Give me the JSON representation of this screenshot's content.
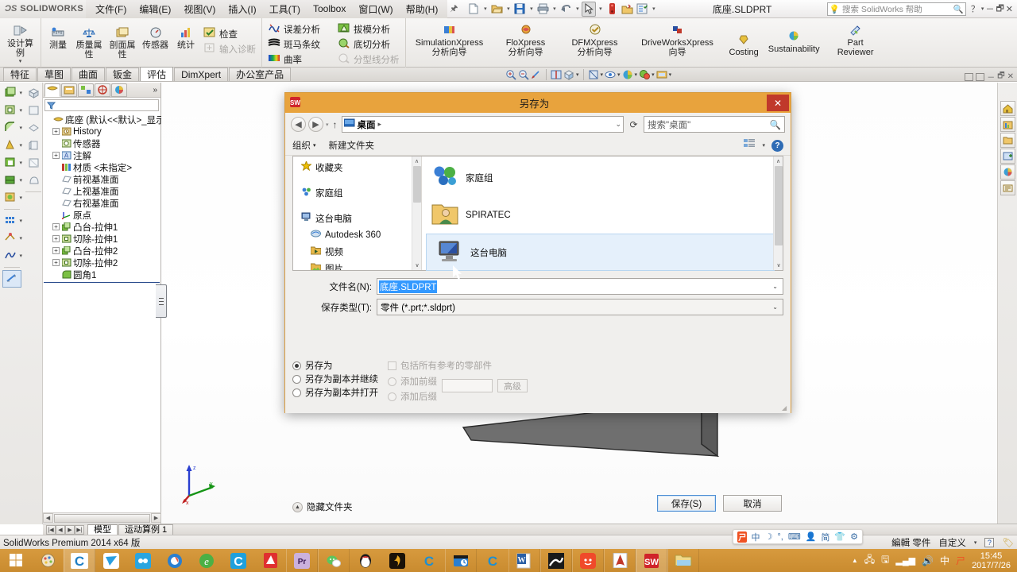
{
  "app": {
    "brand_ds": "ƆS",
    "brand_name": "SOLIDWORKS",
    "document_title": "底座.SLDPRT",
    "help_placeholder": "搜索 SolidWorks 帮助",
    "status_text": "SolidWorks Premium 2014 x64 版",
    "status_edit": "編輯 零件",
    "status_custom": "自定义",
    "accent": "#d79a3e"
  },
  "menu": {
    "items": [
      {
        "label": "文件(F)",
        "name": "menu-file"
      },
      {
        "label": "编辑(E)",
        "name": "menu-edit"
      },
      {
        "label": "视图(V)",
        "name": "menu-view"
      },
      {
        "label": "插入(I)",
        "name": "menu-insert"
      },
      {
        "label": "工具(T)",
        "name": "menu-tools"
      },
      {
        "label": "Toolbox",
        "name": "menu-toolbox"
      },
      {
        "label": "窗口(W)",
        "name": "menu-window"
      },
      {
        "label": "帮助(H)",
        "name": "menu-help"
      }
    ],
    "pin_icon": "pin-icon"
  },
  "quick_access": [
    {
      "name": "new-doc-icon",
      "caret": true
    },
    {
      "name": "open-doc-icon",
      "caret": true
    },
    {
      "name": "save-icon",
      "caret": true
    },
    {
      "name": "print-icon",
      "caret": true
    },
    {
      "name": "undo-icon",
      "caret": true
    },
    {
      "name": "select-icon",
      "caret": true,
      "selected": true
    },
    {
      "name": "rebuild-icon",
      "caret": false
    },
    {
      "name": "options-icon",
      "caret": false
    },
    {
      "name": "settings-icon",
      "caret": true
    }
  ],
  "ribbon": {
    "groups": [
      {
        "name": "design-study-group",
        "buttons": [
          {
            "label": "设计算例",
            "name": "design-study-button",
            "icon": "design-study-icon",
            "caret": true
          }
        ]
      },
      {
        "name": "evaluate-tools-group",
        "buttons": [
          {
            "label": "测量",
            "name": "measure-button",
            "icon": "measure-icon"
          },
          {
            "label": "质量属性",
            "name": "mass-properties-button",
            "icon": "mass-properties-icon"
          },
          {
            "label": "剖面属性",
            "name": "section-properties-button",
            "icon": "section-properties-icon"
          },
          {
            "label": "传感器",
            "name": "sensor-button",
            "icon": "sensor-icon"
          },
          {
            "label": "统计",
            "name": "statistics-button",
            "icon": "statistics-icon"
          }
        ],
        "rows": [
          {
            "label": "检查",
            "name": "check-button",
            "icon": "check-icon",
            "disabled": false
          },
          {
            "label": "输入诊断",
            "name": "import-diagnostics-button",
            "icon": "import-diagnostics-icon",
            "disabled": true
          }
        ]
      },
      {
        "name": "analysis-group",
        "rows": [
          {
            "label": "误差分析",
            "name": "deviation-analysis-button",
            "icon": "deviation-analysis-icon",
            "disabled": false
          },
          {
            "label": "斑马条纹",
            "name": "zebra-stripes-button",
            "icon": "zebra-stripes-icon",
            "disabled": false
          },
          {
            "label": "曲率",
            "name": "curvature-button",
            "icon": "curvature-icon",
            "disabled": false
          },
          {
            "label": "拔模分析",
            "name": "draft-analysis-button",
            "icon": "draft-analysis-icon",
            "disabled": false
          },
          {
            "label": "底切分析",
            "name": "undercut-analysis-button",
            "icon": "undercut-analysis-icon",
            "disabled": false
          },
          {
            "label": "分型线分析",
            "name": "parting-line-analysis-button",
            "icon": "parting-line-analysis-icon",
            "disabled": true
          }
        ]
      },
      {
        "name": "xpress-group",
        "buttons": [
          {
            "label": "SimulationXpress 分析向导",
            "name": "simulationxpress-button",
            "icon": "simulationxpress-icon"
          },
          {
            "label": "FloXpress 分析向导",
            "name": "floxpress-button",
            "icon": "floxpress-icon"
          },
          {
            "label": "DFMXpress 分析向导",
            "name": "dfmxpress-button",
            "icon": "dfmxpress-icon"
          },
          {
            "label": "DriveWorksXpress 向导",
            "name": "driveworksxpress-button",
            "icon": "driveworksxpress-icon"
          },
          {
            "label": "Costing",
            "name": "costing-button",
            "icon": "costing-icon"
          },
          {
            "label": "Sustainability",
            "name": "sustainability-button",
            "icon": "sustainability-icon"
          },
          {
            "label": "Part Reviewer",
            "name": "part-reviewer-button",
            "icon": "part-reviewer-icon"
          }
        ]
      }
    ]
  },
  "command_tabs": [
    {
      "label": "特征",
      "name": "tab-features",
      "active": false
    },
    {
      "label": "草图",
      "name": "tab-sketch",
      "active": false
    },
    {
      "label": "曲面",
      "name": "tab-surfaces",
      "active": false
    },
    {
      "label": "钣金",
      "name": "tab-sheetmetal",
      "active": false
    },
    {
      "label": "评估",
      "name": "tab-evaluate",
      "active": true
    },
    {
      "label": "DimXpert",
      "name": "tab-dimxpert",
      "active": false
    },
    {
      "label": "办公室产品",
      "name": "tab-office-products",
      "active": false
    }
  ],
  "view_toolbar": [
    {
      "name": "zoom-to-fit-icon",
      "caret": false
    },
    {
      "name": "zoom-to-area-icon",
      "caret": false
    },
    {
      "name": "previous-view-icon",
      "caret": false
    },
    {
      "name": "section-view-icon",
      "caret": false
    },
    {
      "name": "view-orientation-icon",
      "caret": true
    },
    {
      "name": "display-style-icon",
      "caret": true
    },
    {
      "name": "hide-show-items-icon",
      "caret": true
    },
    {
      "name": "edit-appearance-icon",
      "caret": true
    },
    {
      "name": "apply-scene-icon",
      "caret": true
    },
    {
      "name": "view-settings-icon",
      "caret": true
    }
  ],
  "feature_tree": {
    "tabs": [
      {
        "name": "feature-manager-tab",
        "active": true
      },
      {
        "name": "property-manager-tab",
        "active": false
      },
      {
        "name": "configuration-manager-tab",
        "active": false
      },
      {
        "name": "dimxpert-manager-tab",
        "active": false
      },
      {
        "name": "display-manager-tab",
        "active": false
      }
    ],
    "more_label": "»",
    "filter_icon": "filter-icon",
    "root": "底座  (默认<<默认>_显示状态",
    "nodes": [
      {
        "label": "History",
        "icon": "history-icon",
        "expandable": true,
        "indent": 1
      },
      {
        "label": "传感器",
        "icon": "sensor-tree-icon",
        "expandable": false,
        "indent": 1
      },
      {
        "label": "注解",
        "icon": "annotations-icon",
        "expandable": true,
        "indent": 1
      },
      {
        "label": "材质 <未指定>",
        "icon": "material-icon",
        "expandable": false,
        "indent": 1
      },
      {
        "label": "前视基准面",
        "icon": "plane-icon",
        "expandable": false,
        "indent": 1
      },
      {
        "label": "上视基准面",
        "icon": "plane-icon",
        "expandable": false,
        "indent": 1
      },
      {
        "label": "右视基准面",
        "icon": "plane-icon",
        "expandable": false,
        "indent": 1
      },
      {
        "label": "原点",
        "icon": "origin-icon",
        "expandable": false,
        "indent": 1
      },
      {
        "label": "凸台-拉伸1",
        "icon": "boss-extrude-icon",
        "expandable": true,
        "indent": 1
      },
      {
        "label": "切除-拉伸1",
        "icon": "cut-extrude-icon",
        "expandable": true,
        "indent": 1
      },
      {
        "label": "凸台-拉伸2",
        "icon": "boss-extrude-icon",
        "expandable": true,
        "indent": 1
      },
      {
        "label": "切除-拉伸2",
        "icon": "cut-extrude-icon",
        "expandable": true,
        "indent": 1
      },
      {
        "label": "圆角1",
        "icon": "fillet-icon",
        "expandable": false,
        "indent": 1
      }
    ]
  },
  "graphics_tabs": {
    "nav": [
      "|◀",
      "◀",
      "▶",
      "▶|"
    ],
    "tabs": [
      {
        "label": "模型",
        "name": "model-tab",
        "active": true
      },
      {
        "label": "运动算例 1",
        "name": "motion-study-tab",
        "active": false
      }
    ]
  },
  "triad": {
    "x": "x",
    "y": "y",
    "z": "z"
  },
  "dialog": {
    "title": "另存为",
    "icon": "solidworks-app-icon",
    "close_label": "✕",
    "nav": {
      "back": "◀",
      "forward": "▶",
      "recent_caret": "▾",
      "up": "↑",
      "breadcrumb_icon": "desktop-icon",
      "breadcrumb": "桌面",
      "breadcrumb_sep": "▸",
      "dropdown_caret": "⌄",
      "refresh_icon": "refresh-icon",
      "search_placeholder": "搜索\"桌面\"",
      "search_icon": "search-icon"
    },
    "commandbar": {
      "organize": "组织",
      "organize_caret": "▾",
      "new_folder": "新建文件夹",
      "view_icon": "view-mode-icon",
      "view_caret": "▾",
      "help_icon": "help-icon",
      "help_label": "?"
    },
    "nav_pane": [
      {
        "label": "收藏夹",
        "name": "nav-favorites",
        "icon": "star-icon",
        "sub": false
      },
      {
        "label": "家庭组",
        "name": "nav-homegroup",
        "icon": "homegroup-icon",
        "sub": false
      },
      {
        "label": "这台电脑",
        "name": "nav-this-pc",
        "icon": "computer-icon",
        "sub": false
      },
      {
        "label": "Autodesk 360",
        "name": "nav-autodesk360",
        "icon": "autodesk360-icon",
        "sub": true
      },
      {
        "label": "视频",
        "name": "nav-videos",
        "icon": "videos-folder-icon",
        "sub": true
      },
      {
        "label": "图片",
        "name": "nav-pictures",
        "icon": "pictures-folder-icon",
        "sub": true
      }
    ],
    "files": [
      {
        "label": "家庭组",
        "name": "file-item-homegroup",
        "icon": "homegroup-large-icon",
        "selected": false
      },
      {
        "label": "SPIRATEC",
        "name": "file-item-spiratec",
        "icon": "user-folder-icon",
        "selected": false
      },
      {
        "label": "这台电脑",
        "name": "file-item-this-pc",
        "icon": "computer-large-icon",
        "selected": true
      }
    ],
    "filename_label": "文件名(N):",
    "filename_value": "底座.SLDPRT",
    "filetype_label": "保存类型(T):",
    "filetype_value": "零件 (*.prt;*.sldprt)",
    "options": {
      "radios": [
        {
          "label": "另存为",
          "name": "radio-save-as",
          "checked": true
        },
        {
          "label": "另存为副本并继续",
          "name": "radio-save-copy-continue",
          "checked": false
        },
        {
          "label": "另存为副本并打开",
          "name": "radio-save-copy-open",
          "checked": false
        }
      ],
      "include_refs": {
        "label": "包括所有参考的零部件",
        "name": "checkbox-include-references",
        "checked": false,
        "disabled": true
      },
      "add_prefix": {
        "label": "添加前缀",
        "name": "radio-add-prefix",
        "checked": false,
        "disabled": true
      },
      "add_suffix": {
        "label": "添加后缀",
        "name": "radio-add-suffix",
        "checked": false,
        "disabled": true
      },
      "text_value": "",
      "advanced_label": "高级",
      "advanced_name": "advanced-button"
    },
    "hide_folders": {
      "label": "隐藏文件夹",
      "name": "hide-folders-toggle",
      "icon": "chevron-up-icon"
    },
    "buttons": {
      "save": "保存(S)",
      "cancel": "取消"
    }
  },
  "ime": {
    "logo": "sogou-icon",
    "items": [
      "中",
      "☽",
      "°,",
      "⌨",
      "👤",
      "简",
      "👕",
      "⚙"
    ]
  },
  "taskbar": {
    "items": [
      {
        "name": "start-button",
        "icon": "windows-logo"
      },
      {
        "name": "taskbar-paint",
        "icon": "paint-icon"
      },
      {
        "name": "taskbar-cad-1",
        "icon": "caxa-icon",
        "active": true
      },
      {
        "name": "taskbar-foxmail",
        "icon": "foxmail-icon"
      },
      {
        "name": "taskbar-baidu-cloud",
        "icon": "baidu-cloud-icon"
      },
      {
        "name": "taskbar-browser-1",
        "icon": "browser-icon"
      },
      {
        "name": "taskbar-edge",
        "icon": "edge-icon"
      },
      {
        "name": "taskbar-cad-2",
        "icon": "caxa-blue-icon"
      },
      {
        "name": "taskbar-pdf-red",
        "icon": "pdf-red-icon"
      },
      {
        "name": "taskbar-premiere",
        "icon": "premiere-icon"
      },
      {
        "name": "taskbar-wechat",
        "icon": "wechat-icon"
      },
      {
        "name": "taskbar-qq",
        "icon": "qq-icon"
      },
      {
        "name": "taskbar-thunder",
        "icon": "thunder-icon"
      },
      {
        "name": "taskbar-caxa-3",
        "icon": "caxa-icon"
      },
      {
        "name": "taskbar-video",
        "icon": "video-icon"
      },
      {
        "name": "taskbar-caxa-4",
        "icon": "caxa-icon"
      },
      {
        "name": "taskbar-word",
        "icon": "word-icon"
      },
      {
        "name": "taskbar-photoshop",
        "icon": "image-icon"
      },
      {
        "name": "taskbar-360",
        "icon": "360-icon"
      },
      {
        "name": "taskbar-acrobat",
        "icon": "acrobat-icon"
      },
      {
        "name": "taskbar-solidworks",
        "icon": "solidworks-icon",
        "active": true
      },
      {
        "name": "taskbar-explorer",
        "icon": "explorer-icon"
      }
    ],
    "tray": {
      "expand": "▲",
      "icons": [
        "network-error-icon",
        "usb-icon",
        "signal-icon",
        "volume-icon"
      ],
      "ime_label": "中",
      "ime_logo": "sogou-icon",
      "time": "15:45",
      "date": "2017/7/26"
    }
  }
}
